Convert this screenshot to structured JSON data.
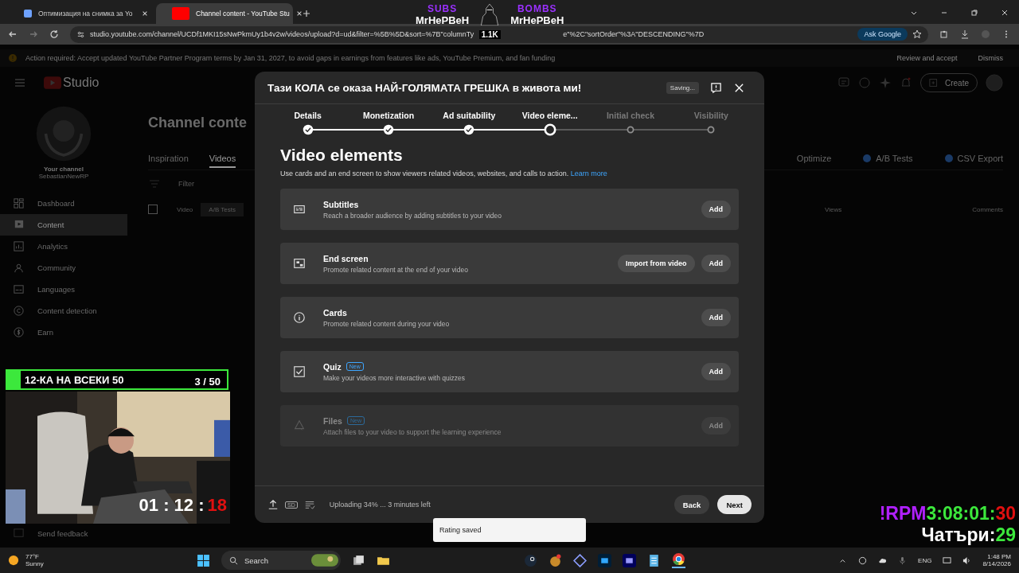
{
  "browser": {
    "tabs": [
      {
        "title": "Оптимизация на снимка за Yo",
        "selected": false
      },
      {
        "title": "Channel content - YouTube Stu",
        "selected": true
      }
    ],
    "url_start": "studio.youtube.com/channel/UCDf1MKI15sNwPkmUy1b4v2w/videos/upload?d=ud&filter=%5B%5D&sort=%7B\"columnTy",
    "url_end": "e\"%2C\"sortOrder\"%3A\"DESCENDING\"%7D",
    "ask_button": "Ask Google"
  },
  "banner": {
    "text": "Action required: Accept updated YouTube Partner Program terms by Jan 31, 2027, to avoid gaps in earnings from features like ads, YouTube Premium, and fan funding",
    "buttons": [
      "Review and accept",
      "Dismiss"
    ]
  },
  "studio": {
    "logo": "Studio",
    "create": "Create",
    "sidebar": {
      "channel_label": "Your channel",
      "channel_name": "SebastianNewRP",
      "items": [
        {
          "label": "Dashboard",
          "selected": false
        },
        {
          "label": "Content",
          "selected": true
        },
        {
          "label": "Analytics",
          "selected": false
        },
        {
          "label": "Community",
          "selected": false
        },
        {
          "label": "Languages",
          "selected": false
        },
        {
          "label": "Content detection",
          "selected": false
        },
        {
          "label": "Earn",
          "selected": false
        }
      ],
      "feedback": "Send feedback"
    },
    "page_title": "Channel conte",
    "tabs": [
      {
        "label": "Inspiration",
        "selected": false
      },
      {
        "label": "Videos",
        "selected": true
      }
    ],
    "tools": [
      "Optimize",
      "A/B Tests",
      "CSV Export"
    ],
    "filter_placeholder": "Filter",
    "select_all": {
      "checked": false
    },
    "columns": [
      "Video",
      "A/B Tests",
      "Views",
      "Comments"
    ]
  },
  "dialog": {
    "title": "Тази КОЛА се оказа НАЙ-ГОЛЯМАТА ГРЕШКА в живота ми!",
    "status": "Saving...",
    "steps": [
      {
        "label": "Details",
        "checked": true,
        "selected": false
      },
      {
        "label": "Monetization",
        "checked": true,
        "selected": false
      },
      {
        "label": "Ad suitability",
        "checked": true,
        "selected": false
      },
      {
        "label": "Video eleme...",
        "checked": false,
        "selected": true
      },
      {
        "label": "Initial check",
        "checked": false,
        "selected": false
      },
      {
        "label": "Visibility",
        "checked": false,
        "selected": false
      }
    ],
    "heading": "Video elements",
    "description": "Use cards and an end screen to show viewers related videos, websites, and calls to action.",
    "link": "Learn more",
    "elements": [
      {
        "title": "Subtitles",
        "subtitle": "Reach a broader audience by adding subtitles to your video",
        "disabled": false,
        "buttons": [
          "Add"
        ]
      },
      {
        "title": "End screen",
        "subtitle": "Promote related content at the end of your video",
        "disabled": false,
        "buttons": [
          "Import from video",
          "Add"
        ]
      },
      {
        "title": "Cards",
        "subtitle": "Promote related content during your video",
        "disabled": false,
        "buttons": [
          "Add"
        ]
      },
      {
        "title": "Quiz",
        "badge": "New",
        "subtitle": "Make your videos more interactive with quizzes",
        "disabled": false,
        "buttons": [
          "Add"
        ]
      },
      {
        "title": "Files",
        "badge": "New",
        "subtitle": "Attach files to your video to support the learning experience",
        "disabled": true,
        "buttons": [
          "Add"
        ]
      }
    ],
    "footer": {
      "sd": "SD",
      "progress": "Uploading 34% ... 3 minutes left",
      "back": "Back",
      "next": "Next"
    }
  },
  "toast": "Rating saved",
  "overlay": {
    "subs_label": "SUBS",
    "subs_name": "MrHePBeH",
    "bombs_label": "BOMBS",
    "bombs_name": "MrHePBeH",
    "count": "1.1K",
    "goal": {
      "title": "12-КА НА ВСЕКИ 50",
      "progress": "3 / 50",
      "level": 0.06
    },
    "cam_timer": "01 : 12 :",
    "cam_timer_end": "18",
    "rpm_label": "!RPM",
    "rpm_timer": "3:08:01:",
    "rpm_timer_end": "30",
    "chatters_label": "Чатъри:",
    "chatters_count": "29"
  },
  "taskbar": {
    "temperature": "77°F",
    "weather": "Sunny",
    "search": "Search",
    "language": "ENG",
    "time": "1:48 PM",
    "date": "8/14/2026"
  }
}
